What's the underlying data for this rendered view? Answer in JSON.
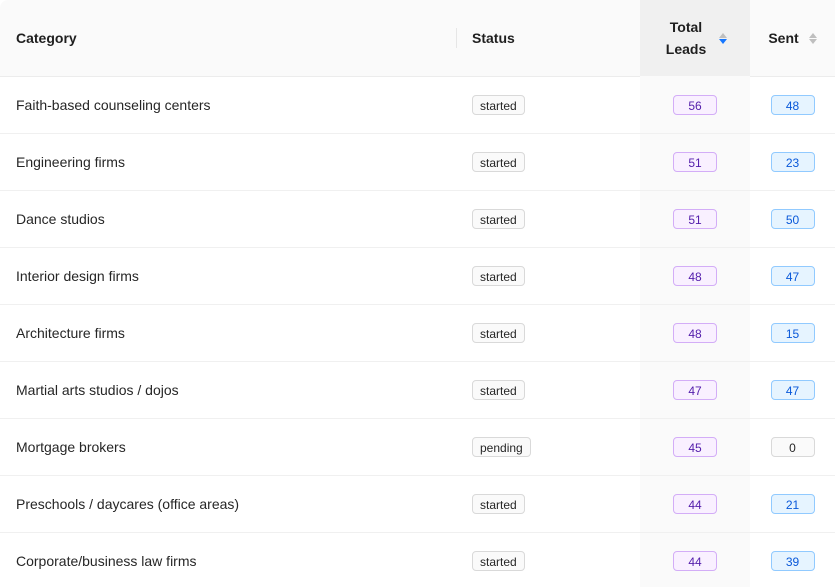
{
  "table": {
    "columns": {
      "category": "Category",
      "status": "Status",
      "total_leads": "Total Leads",
      "sent": "Sent"
    },
    "sort": {
      "total_leads": "descending",
      "sent": "none"
    },
    "colors": {
      "header_bg": "#fafafa",
      "sorted_col_bg": "#f0f0f0",
      "leads_tag": "#531dab",
      "sent_tag": "#0958d9",
      "sort_active": "#1677ff"
    },
    "rows": [
      {
        "category": "Faith-based counseling centers",
        "status": "started",
        "total_leads": "56",
        "sent": "48"
      },
      {
        "category": "Engineering firms",
        "status": "started",
        "total_leads": "51",
        "sent": "23"
      },
      {
        "category": "Dance studios",
        "status": "started",
        "total_leads": "51",
        "sent": "50"
      },
      {
        "category": "Interior design firms",
        "status": "started",
        "total_leads": "48",
        "sent": "47"
      },
      {
        "category": "Architecture firms",
        "status": "started",
        "total_leads": "48",
        "sent": "15"
      },
      {
        "category": "Martial arts studios / dojos",
        "status": "started",
        "total_leads": "47",
        "sent": "47"
      },
      {
        "category": "Mortgage brokers",
        "status": "pending",
        "total_leads": "45",
        "sent": "0"
      },
      {
        "category": "Preschools / daycares (office areas)",
        "status": "started",
        "total_leads": "44",
        "sent": "21"
      },
      {
        "category": "Corporate/business law firms",
        "status": "started",
        "total_leads": "44",
        "sent": "39"
      }
    ]
  }
}
